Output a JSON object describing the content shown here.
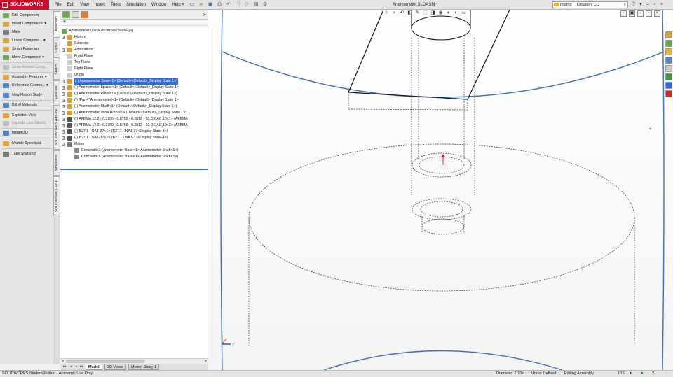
{
  "app": {
    "logo_text": "SOLIDWORKS",
    "document_title": "Anemometer.SLDASM *"
  },
  "menus": [
    "File",
    "Edit",
    "View",
    "Insert",
    "Tools",
    "Simulation",
    "Window",
    "Help"
  ],
  "search": {
    "value": "mating",
    "scope": "Location: CC"
  },
  "command_manager": {
    "items": [
      {
        "label": "Edit Component",
        "icon": "edit-component-icon",
        "color": "#6aa84f"
      },
      {
        "label": "Insert Components",
        "icon": "insert-component-icon",
        "color": "#d9a13a"
      },
      {
        "label": "Mate",
        "icon": "mate-icon",
        "color": "#7a7a7a"
      },
      {
        "label": "Linear Compone...",
        "icon": "linear-pattern-icon",
        "color": "#d9a13a"
      },
      {
        "label": "Smart Fasteners",
        "icon": "smart-fastener-icon",
        "color": "#d9a13a"
      },
      {
        "label": "Move Component",
        "icon": "move-component-icon",
        "color": "#6aa84f"
      },
      {
        "label": "Show Hidden Comp...",
        "icon": "show-hidden-icon",
        "color": "#bbbbbb",
        "disabled": true
      },
      {
        "label": "Assembly Features",
        "icon": "assembly-features-icon",
        "color": "#d9a13a"
      },
      {
        "label": "Reference Geome...",
        "icon": "reference-geometry-icon",
        "color": "#4a86c5"
      },
      {
        "label": "New Motion Study",
        "icon": "motion-study-icon",
        "color": "#4a86c5"
      },
      {
        "label": "Bill of Materials",
        "icon": "bom-icon",
        "color": "#4a86c5"
      },
      {
        "label": "Exploded View",
        "icon": "exploded-view-icon",
        "color": "#d9a13a"
      },
      {
        "label": "Explode Line Sketch",
        "icon": "explode-line-icon",
        "color": "#bbbbbb",
        "disabled": true
      },
      {
        "label": "Instant3D",
        "icon": "instant3d-icon",
        "color": "#4a86c5"
      },
      {
        "label": "Update Speedpak",
        "icon": "speedpak-icon",
        "color": "#d9a13a"
      },
      {
        "label": "Take Snapshot",
        "icon": "snapshot-icon",
        "color": "#7a7a7a"
      }
    ],
    "tabs": [
      "Assembly",
      "Layout",
      "Sketch",
      "Evaluate",
      "SOLIDWORKS Add-Ins",
      "Simulation",
      "SOLIDWORKS MBD"
    ]
  },
  "feature_tree": {
    "root": "Anemometer  (Default<Display State-1>)",
    "items": [
      {
        "label": "History",
        "icon": "history-icon",
        "color": "#d9a13a",
        "indent": 1,
        "expander": "+"
      },
      {
        "label": "Sensors",
        "icon": "sensors-icon",
        "color": "#d9a13a",
        "indent": 1,
        "expander": ""
      },
      {
        "label": "Annotations",
        "icon": "annotations-icon",
        "color": "#d9a13a",
        "indent": 1,
        "expander": "+"
      },
      {
        "label": "Front Plane",
        "icon": "plane-icon",
        "color": "#cccccc",
        "indent": 1,
        "expander": ""
      },
      {
        "label": "Top Plane",
        "icon": "plane-icon",
        "color": "#cccccc",
        "indent": 1,
        "expander": ""
      },
      {
        "label": "Right Plane",
        "icon": "plane-icon",
        "color": "#cccccc",
        "indent": 1,
        "expander": ""
      },
      {
        "label": "Origin",
        "icon": "origin-icon",
        "color": "#cccccc",
        "indent": 1,
        "expander": ""
      },
      {
        "label": "(-) Anemometer Base<1> (Default<<Default>_Display State 1>)",
        "icon": "part-icon",
        "color": "#d9a13a",
        "indent": 1,
        "expander": "+",
        "selected": true
      },
      {
        "label": "(-) Anemometer Spacer<1> (Default<<Default>_Display State 1>)",
        "icon": "part-icon",
        "color": "#d9a13a",
        "indent": 1,
        "expander": "+"
      },
      {
        "label": "(-) Anemometer Rotor<1> (Default<<Default>_Display State 1>)",
        "icon": "part-icon",
        "color": "#d9a13a",
        "indent": 1,
        "expander": "+"
      },
      {
        "label": "(f) [Part4^Anemometer]<1> (Default<<Default>_Display State 1>)",
        "icon": "part-icon",
        "color": "#d9a13a",
        "indent": 1,
        "expander": "+"
      },
      {
        "label": "(-) Anemometer Shaft<1> (Default<<Default>_Display State 1>)",
        "icon": "part-icon",
        "color": "#d9a13a",
        "indent": 1,
        "expander": "+"
      },
      {
        "label": "(-) Anemometer Vane Rotor<1> (Default<<Default>_Display State 1>)",
        "icon": "part-icon",
        "color": "#d9a13a",
        "indent": 1,
        "expander": "+"
      },
      {
        "label": "(-) AFBMA 12.2 - 0.3750 - 0.8750 - 0.2812 - 10,DE,AC,10<1> (AFBMA",
        "icon": "toolbox-icon",
        "color": "#555555",
        "indent": 1,
        "expander": "+"
      },
      {
        "label": "(-) AFBMA 12.2 - 0.3750 - 0.8750 - 0.2812 - 10,DE,AC,10<2> (AFBMA",
        "icon": "toolbox-icon",
        "color": "#555555",
        "indent": 1,
        "expander": "+"
      },
      {
        "label": "(-) B27.1 - NA1-37<1> (B27.1 - NA1-37<Display State-4>)",
        "icon": "toolbox-icon",
        "color": "#555555",
        "indent": 1,
        "expander": "+"
      },
      {
        "label": "(-) B27.1 - NA1-37<2> (B27.1 - NA1-37<Display State-4>)",
        "icon": "toolbox-icon",
        "color": "#555555",
        "indent": 1,
        "expander": "+"
      },
      {
        "label": "Mates",
        "icon": "mates-icon",
        "color": "#7a7a7a",
        "indent": 1,
        "expander": "−"
      },
      {
        "label": "Concentric1 (Anemometer Base<1>,Anemometer Shaft<1>)",
        "icon": "concentric-mate-icon",
        "color": "#888888",
        "indent": 2,
        "expander": ""
      },
      {
        "label": "Concentric6 (Anemometer Base<1>,Anemometer Shaft<1>)",
        "icon": "concentric-mate-icon",
        "color": "#888888",
        "indent": 2,
        "expander": ""
      }
    ]
  },
  "bottom_tabs": [
    "Model",
    "3D Views",
    "Motion Study 1"
  ],
  "statusbar": {
    "edition": "SOLIDWORKS Student Edition - Academic Use Only",
    "measure": "Diameter: 2.73in",
    "state": "Under Defined",
    "mode": "Editing Assembly",
    "units": "IPS"
  },
  "colors": {
    "selection": "#2f6bd8",
    "model_edge": "#3c6fb5",
    "logo_bg": "#c8102e"
  }
}
